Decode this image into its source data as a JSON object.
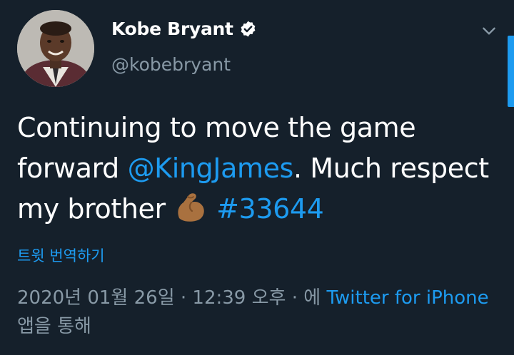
{
  "author": {
    "name": "Kobe Bryant",
    "handle": "@kobebryant",
    "verified": true
  },
  "tweet": {
    "text_part1": "Continuing to move the game forward ",
    "mention": "@KingJames",
    "text_part2": ". Much respect my brother ",
    "emoji": "flexed-biceps",
    "text_part3": " ",
    "hashtag": "#33644"
  },
  "translate_label": "트윗 번역하기",
  "meta": {
    "timestamp": "2020년 01월 26일 · 12:39 오후 · 에 ",
    "client": "Twitter for iPhone",
    "suffix": " 앱을 통해"
  },
  "colors": {
    "background": "#15202b",
    "accent": "#1d9bf0",
    "secondary_text": "#8899a6"
  },
  "icons": [
    "verified-badge-icon",
    "chevron-down-icon",
    "flexed-biceps-emoji"
  ]
}
